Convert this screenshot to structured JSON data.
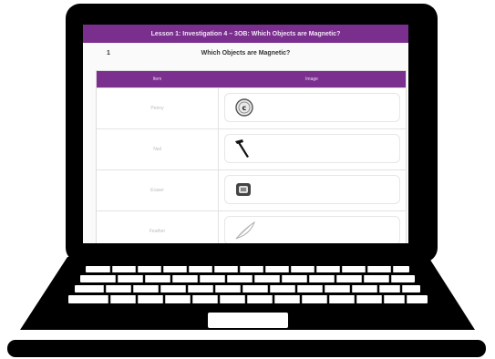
{
  "app": {
    "title": "Lesson 1: Investigation 4 – 3OB: Which Objects are Magnetic?",
    "question_number": "1",
    "question_title": "Which Objects are Magnetic?"
  },
  "table": {
    "headers": [
      "Item",
      "Image"
    ],
    "rows": [
      {
        "item": "Penny",
        "icon": "coin-icon"
      },
      {
        "item": "Nail",
        "icon": "nail-icon"
      },
      {
        "item": "Eraser",
        "icon": "eraser-icon"
      },
      {
        "item": "Feather",
        "icon": "feather-icon"
      }
    ]
  },
  "colors": {
    "accent": "#7b2f8f",
    "frame": "#000000"
  }
}
